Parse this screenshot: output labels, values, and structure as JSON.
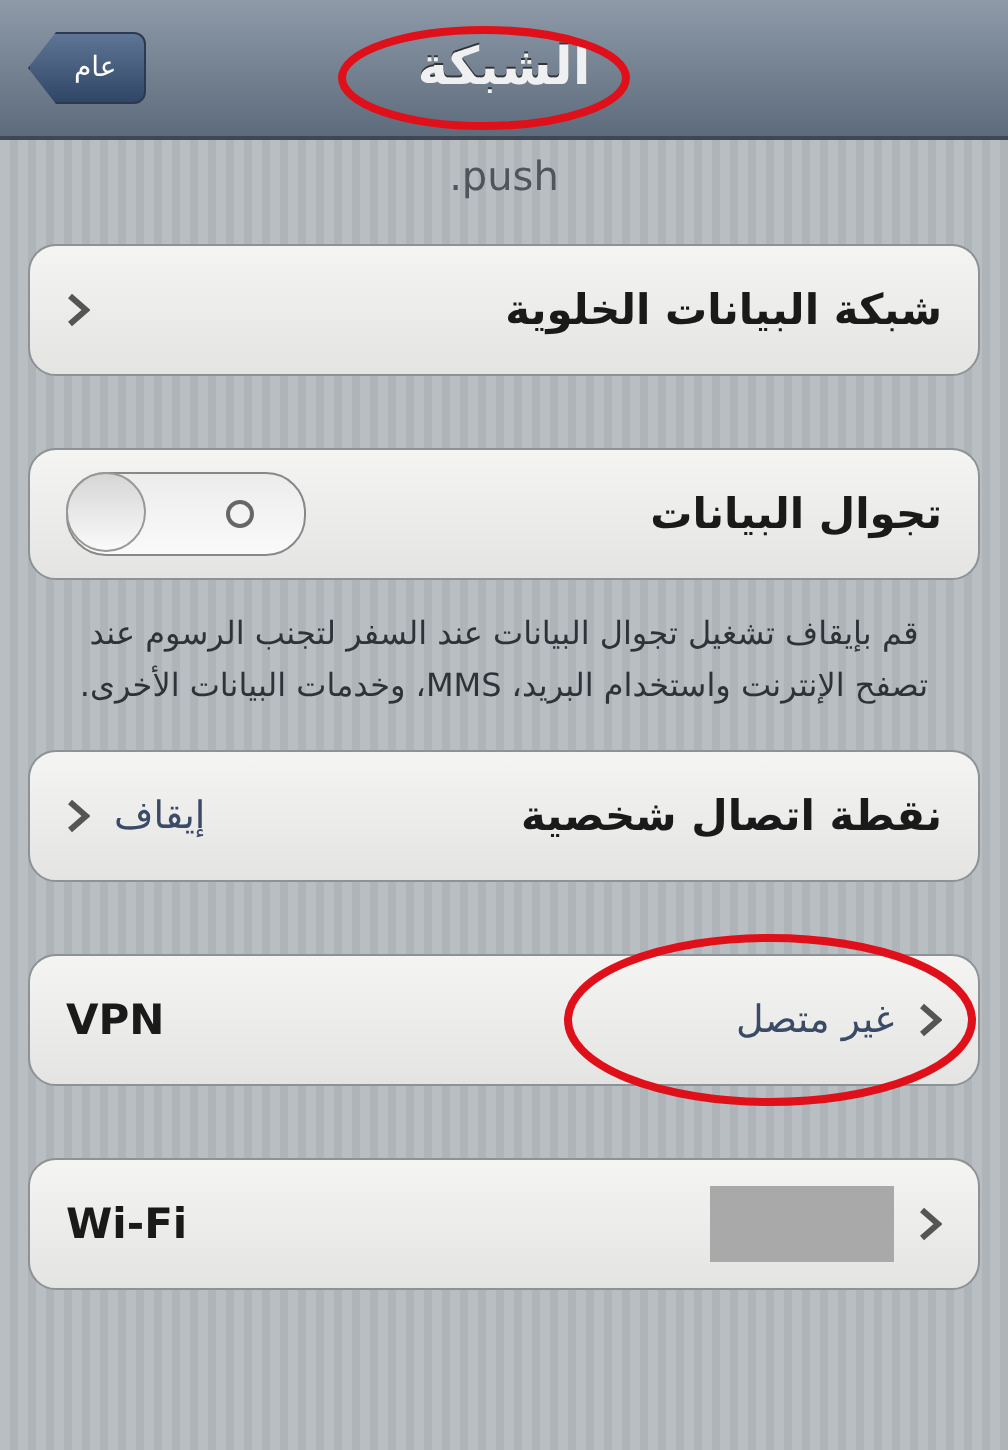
{
  "nav_bar": {
    "title": "الشبكة",
    "title_highlighted": true,
    "back_button": "عام"
  },
  "top_note": ".push",
  "groups": [
    {
      "rows": [
        {
          "kind": "link",
          "label": "شبكة البيانات الخلوية"
        }
      ]
    },
    {
      "rows": [
        {
          "kind": "switch",
          "label": "تجوال البيانات",
          "on": false
        }
      ],
      "footer": "قم بإيقاف تشغيل تجوال البيانات عند السفر لتجنب الرسوم عند تصفح الإنترنت واستخدام البريد، MMS، وخدمات البيانات الأخرى."
    },
    {
      "rows": [
        {
          "kind": "link",
          "label": "نقطة اتصال شخصية",
          "value": "إيقاف",
          "highlighted": false
        }
      ]
    },
    {
      "rows": [
        {
          "kind": "link",
          "label": "VPN",
          "left_to_right": true,
          "value": "غير متصل",
          "highlighted": true
        }
      ]
    },
    {
      "rows": [
        {
          "kind": "link",
          "label": "Wi-Fi",
          "left_to_right": true,
          "redacted": true
        }
      ]
    }
  ]
}
